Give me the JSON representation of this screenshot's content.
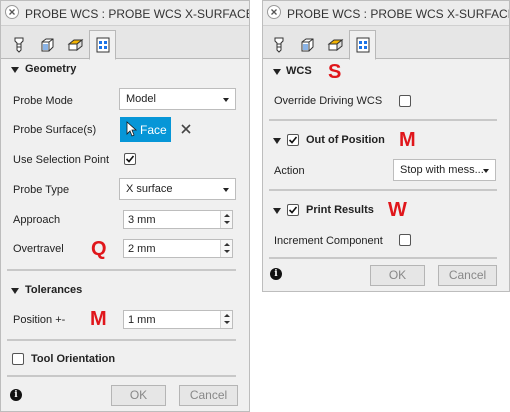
{
  "colors": {
    "accent": "#0696d7",
    "annotation": "#e0161b"
  },
  "left": {
    "title": "PROBE WCS : PROBE WCS X-SURFACE",
    "tabs": [
      "tool-icon",
      "geometry-icon",
      "passes-icon",
      "probe-cycle-icon"
    ],
    "geometry": {
      "header": "Geometry",
      "probe_mode_label": "Probe Mode",
      "probe_mode_value": "Model",
      "probe_surfaces_label": "Probe Surface(s)",
      "face_label": "Face",
      "use_selection_point_label": "Use Selection Point",
      "use_selection_point_checked": true,
      "probe_type_label": "Probe Type",
      "probe_type_value": "X surface",
      "approach_label": "Approach",
      "approach_value": "3 mm",
      "overtravel_label": "Overtravel",
      "overtravel_value": "2 mm",
      "overtravel_annotation": "Q"
    },
    "tolerances": {
      "header": "Tolerances",
      "position_label": "Position +-",
      "position_value": "1 mm",
      "position_annotation": "M"
    },
    "tool_orientation": {
      "label": "Tool Orientation",
      "checked": false
    },
    "ok": "OK",
    "cancel": "Cancel"
  },
  "right": {
    "title": "PROBE WCS : PROBE WCS X-SURFACE",
    "tabs": [
      "tool-icon",
      "geometry-icon",
      "passes-icon",
      "probe-cycle-icon"
    ],
    "wcs": {
      "header": "WCS",
      "annotation": "S",
      "override_label": "Override Driving WCS",
      "override_checked": false
    },
    "out_of_position": {
      "header": "Out of Position",
      "checked": true,
      "annotation": "M",
      "action_label": "Action",
      "action_value": "Stop with mess..."
    },
    "print_results": {
      "header": "Print Results",
      "checked": true,
      "annotation": "W",
      "increment_label": "Increment Component",
      "increment_checked": false
    },
    "ok": "OK",
    "cancel": "Cancel"
  }
}
